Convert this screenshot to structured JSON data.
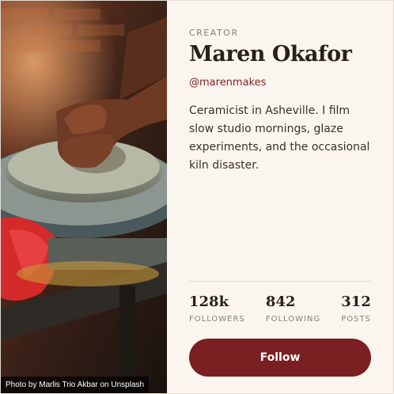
{
  "photo": {
    "credit": "Photo by Marlis Trio Akbar on Unsplash",
    "subject": "hands-shaping-clay-on-pottery-wheel"
  },
  "profile": {
    "eyebrow": "CREATOR",
    "name": "Maren Okafor",
    "handle": "@marenmakes",
    "bio": "Ceramicist in Asheville. I film slow studio mornings, glaze experiments, and the occasional kiln disaster."
  },
  "stats": [
    {
      "value": "128k",
      "label": "FOLLOWERS"
    },
    {
      "value": "842",
      "label": "FOLLOWING"
    },
    {
      "value": "312",
      "label": "POSTS"
    }
  ],
  "actions": {
    "follow_label": "Follow"
  },
  "colors": {
    "accent": "#7a1f22",
    "background": "#fbf5ef",
    "text": "#2a201b",
    "muted": "#8a7f74"
  }
}
